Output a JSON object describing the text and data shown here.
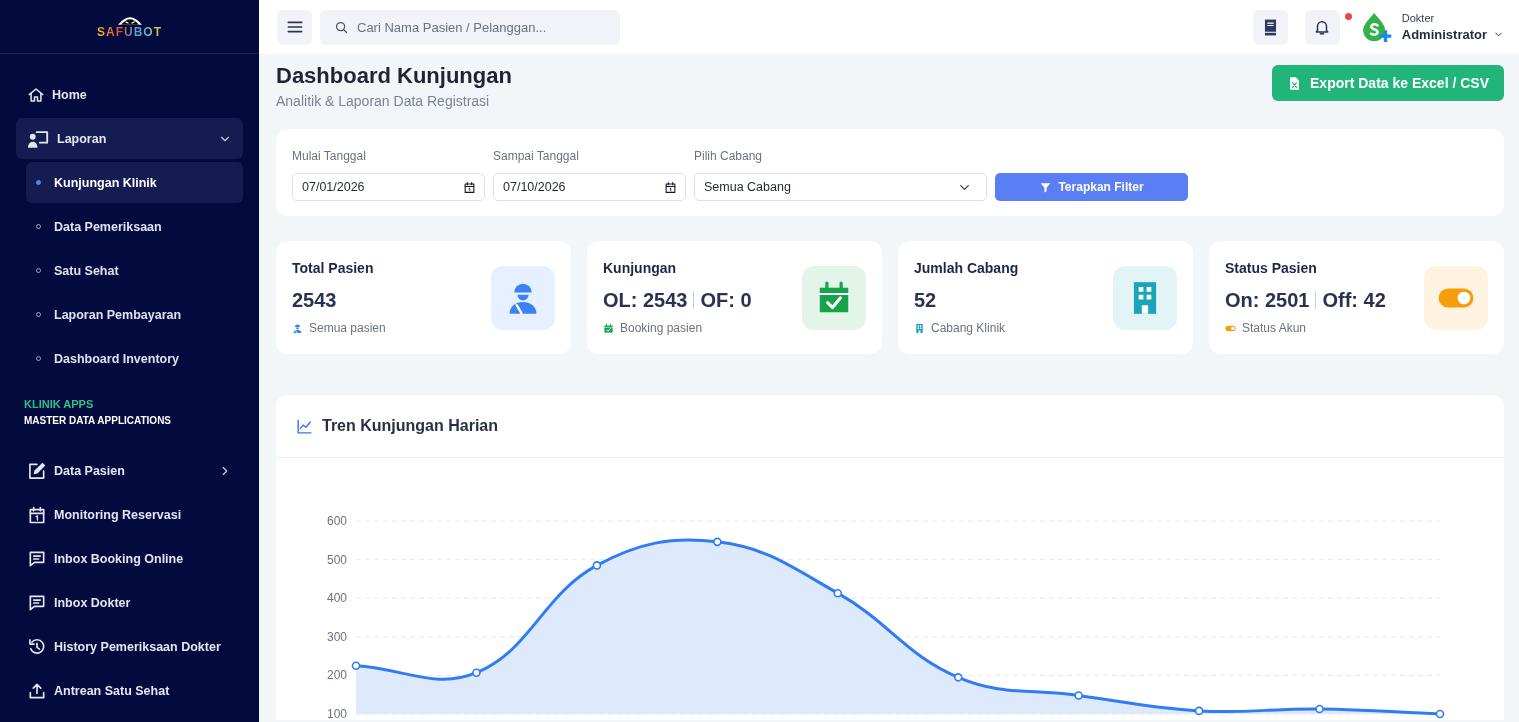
{
  "sidebar": {
    "logo_text": "SAFUBOT",
    "menu": [
      {
        "label": "Home",
        "kind": "link",
        "selected": false
      },
      {
        "label": "Laporan",
        "kind": "group",
        "selected": true,
        "expanded": true,
        "children": [
          {
            "label": "Kunjungan Klinik",
            "selected": true
          },
          {
            "label": "Data Pemeriksaan",
            "selected": false
          },
          {
            "label": "Satu Sehat",
            "selected": false
          },
          {
            "label": "Laporan Pembayaran",
            "selected": false
          },
          {
            "label": "Dashboard Inventory",
            "selected": false
          }
        ]
      }
    ],
    "section": {
      "title": "KLINIK APPS",
      "subtitle": "MASTER DATA APPLICATIONS"
    },
    "apps_menu": [
      {
        "label": "Data Pasien",
        "kind": "group",
        "selected": false,
        "expanded": false
      },
      {
        "label": "Monitoring Reservasi",
        "kind": "link",
        "selected": false
      },
      {
        "label": "Inbox Booking Online",
        "kind": "link",
        "selected": false
      },
      {
        "label": "Inbox Dokter",
        "kind": "link",
        "selected": false
      },
      {
        "label": "History Pemeriksaan Dokter",
        "kind": "link",
        "selected": false
      },
      {
        "label": "Antrean Satu Sehat",
        "kind": "link",
        "selected": false
      }
    ]
  },
  "topbar": {
    "search": {
      "placeholder": "Cari Nama Pasien / Pelanggan..."
    },
    "notifications": {
      "unread": true
    },
    "user": {
      "role": "Dokter",
      "name": "Administrator"
    }
  },
  "page_header": {
    "title": "Dashboard Kunjungan",
    "subtitle": "Analitik & Laporan Data Registrasi",
    "export_button": "Export Data ke Excel / CSV"
  },
  "filters": {
    "fields": [
      {
        "label": "Mulai Tanggal",
        "kind": "date",
        "value": "07/01/2026"
      },
      {
        "label": "Sampai Tanggal",
        "kind": "date",
        "value": "07/10/2026"
      },
      {
        "label": "Pilih Cabang",
        "kind": "select",
        "value": "Semua Cabang"
      }
    ],
    "apply_button": "Terapkan Filter"
  },
  "stats": [
    {
      "title": "Total Pasien",
      "values": [
        "2543"
      ],
      "note": "Semua pasien",
      "color": "#3b82f6"
    },
    {
      "title": "Kunjungan",
      "values": [
        "OL: 2543",
        "OF: 0"
      ],
      "note": "Booking pasien",
      "color": "#16a34a"
    },
    {
      "title": "Jumlah Cabang",
      "values": [
        "52"
      ],
      "note": "Cabang Klinik",
      "color": "#1aa5b8"
    },
    {
      "title": "Status Pasien",
      "values": [
        "On: 2501",
        "Off: 42"
      ],
      "note": "Status Akun",
      "color": "#f59e0b"
    }
  ],
  "trend_card": {
    "title": "Tren Kunjungan Harian",
    "chart_data": {
      "type": "area",
      "ylim": [
        100,
        600
      ],
      "yticks": [
        100,
        200,
        300,
        400,
        500,
        600
      ],
      "grid": true,
      "values": [
        225,
        207,
        485,
        546,
        413,
        195,
        148,
        108,
        113,
        100
      ]
    }
  }
}
